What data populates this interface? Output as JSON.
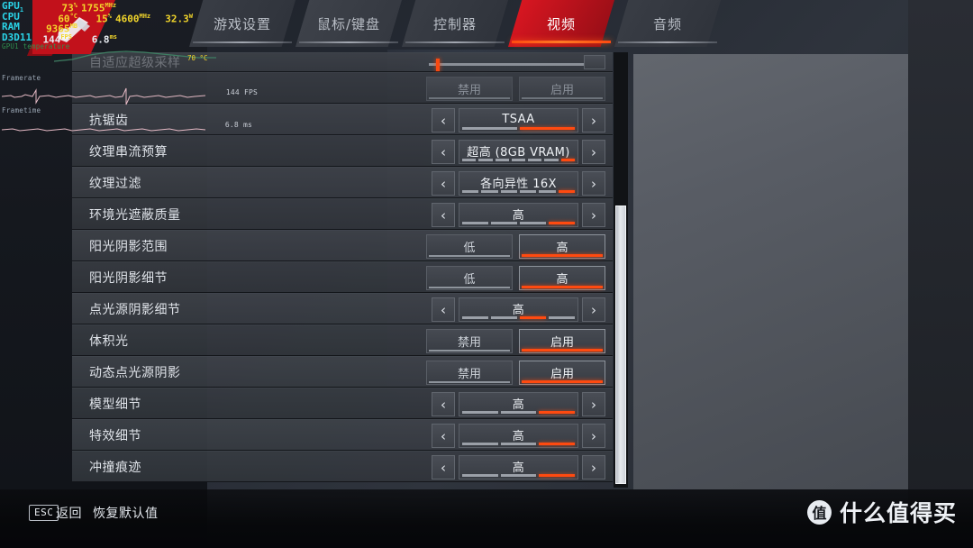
{
  "osd": {
    "rows": [
      {
        "label": "GPU",
        "sub": "1",
        "v1": "73",
        "u1": "%",
        "v2": "1755",
        "u2": "MHz",
        "v3": "",
        "u3": "",
        "v4": "",
        "u4": ""
      },
      {
        "label": "CPU",
        "sub": "",
        "v1": "60",
        "u1": "°C",
        "v2": "15",
        "u2": "%",
        "v3": "4600",
        "u3": "MHz",
        "v4": "32.3",
        "u4": "W"
      },
      {
        "label": "RAM",
        "sub": "",
        "v1": "9365",
        "u1": "MB",
        "v2": "",
        "u2": "",
        "v3": "",
        "u3": "",
        "v4": "",
        "u4": ""
      },
      {
        "label": "D3D11",
        "sub": "",
        "v1": "144",
        "u1": "FPS",
        "v2": "6.8",
        "u2": "ms",
        "v3": "",
        "u3": "",
        "v4": "",
        "u4": ""
      }
    ],
    "caption": "GPU1 temperature",
    "graphs": [
      {
        "title": "Framerate",
        "value": "144 FPS"
      },
      {
        "title": "Frametime",
        "value": "6.8 ms"
      }
    ],
    "temp_label": "70 °C"
  },
  "tabs": [
    {
      "label": "游戏设置",
      "active": false
    },
    {
      "label": "鼠标/键盘",
      "active": false
    },
    {
      "label": "控制器",
      "active": false
    },
    {
      "label": "视频",
      "active": true
    },
    {
      "label": "音频",
      "active": false
    }
  ],
  "settings": {
    "rows": [
      {
        "label": "自适应超级采样",
        "type": "slider_partial",
        "knob_pct": 4
      },
      {
        "label": "",
        "type": "toggle",
        "dim": true,
        "options": [
          "禁用",
          "启用"
        ],
        "selected": -1
      },
      {
        "label": "抗锯齿",
        "type": "stepper",
        "value": "TSAA",
        "segments": 2,
        "active_segment": 2
      },
      {
        "label": "纹理串流预算",
        "type": "stepper",
        "value": "超高 (8GB VRAM)",
        "segments": 7,
        "active_segment": 7
      },
      {
        "label": "纹理过滤",
        "type": "stepper",
        "value": "各向异性 16X",
        "segments": 6,
        "active_segment": 6
      },
      {
        "label": "环境光遮蔽质量",
        "type": "stepper",
        "value": "高",
        "segments": 4,
        "active_segment": 4
      },
      {
        "label": "阳光阴影范围",
        "type": "toggle",
        "options": [
          "低",
          "高"
        ],
        "selected": 1
      },
      {
        "label": "阳光阴影细节",
        "type": "toggle",
        "options": [
          "低",
          "高"
        ],
        "selected": 1
      },
      {
        "label": "点光源阴影细节",
        "type": "stepper",
        "value": "高",
        "segments": 4,
        "active_segment": 3
      },
      {
        "label": "体积光",
        "type": "toggle",
        "options": [
          "禁用",
          "启用"
        ],
        "selected": 1
      },
      {
        "label": "动态点光源阴影",
        "type": "toggle",
        "options": [
          "禁用",
          "启用"
        ],
        "selected": 1
      },
      {
        "label": "模型细节",
        "type": "stepper",
        "value": "高",
        "segments": 3,
        "active_segment": 3
      },
      {
        "label": "特效细节",
        "type": "stepper",
        "value": "高",
        "segments": 3,
        "active_segment": 3
      },
      {
        "label": "冲撞痕迹",
        "type": "stepper",
        "value": "高",
        "segments": 3,
        "active_segment": 3
      }
    ],
    "arrow_left": "‹",
    "arrow_right": "›"
  },
  "footer": {
    "esc_key": "ESC",
    "esc_label": "返回",
    "restore_defaults": "恢复默认值"
  },
  "watermark": {
    "mark": "值",
    "text": "什么值得买"
  },
  "colors": {
    "accent": "#ff4a10",
    "tab_active_bg": "#c2111b",
    "osd_label": "#2ad4e8",
    "osd_value": "#f3d62b"
  }
}
